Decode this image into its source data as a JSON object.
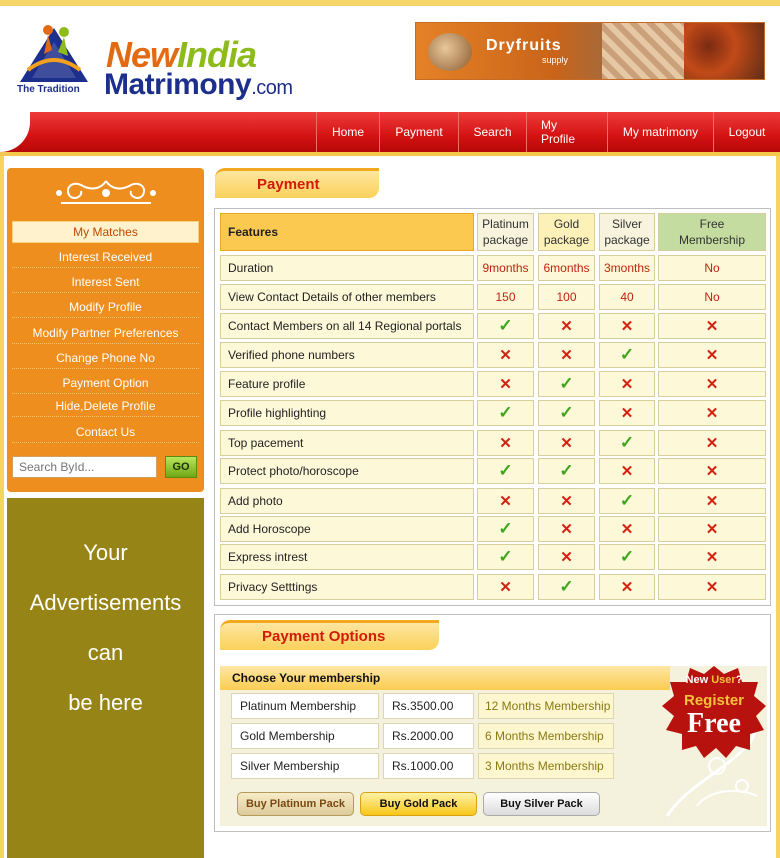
{
  "header": {
    "logo_new": "New",
    "logo_india": "India",
    "logo_matrimony": "Matrimony",
    "logo_com": ".com",
    "logo_tagline": "The Tradition",
    "ad_title": "Dryfruits",
    "ad_subtitle": "supply"
  },
  "nav": {
    "items": [
      "Home",
      "Payment",
      "Search",
      "My Profile",
      "My matrimony",
      "Logout"
    ]
  },
  "sidebar": {
    "items": [
      "My Matches",
      "Interest Received",
      "Interest Sent",
      "Modify Profile",
      "Modify Partner Preferences",
      "Change Phone No",
      "Payment Option",
      "Hide,Delete Profile",
      "Contact Us"
    ],
    "search_placeholder": "Search ById...",
    "go_label": "GO",
    "adv_lines": [
      "Your",
      "Advertisements",
      "can",
      "be here"
    ]
  },
  "payment": {
    "heading": "Payment",
    "headers": {
      "features": "Features",
      "platinum_1": "Platinum",
      "platinum_2": "package",
      "gold_1": "Gold",
      "gold_2": "package",
      "silver_1": "Silver",
      "silver_2": "package",
      "free_1": "Free",
      "free_2": "Membership"
    },
    "rows": [
      {
        "feature": "Duration",
        "platinum": "9months",
        "gold": "6months",
        "silver": "3months",
        "free": "No"
      },
      {
        "feature": "View Contact Details of other members",
        "platinum": "150",
        "gold": "100",
        "silver": "40",
        "free": "No"
      },
      {
        "feature": "Contact Members on all 14 Regional portals",
        "platinum": "yes",
        "gold": "no",
        "silver": "no",
        "free": "no"
      },
      {
        "feature": "Verified phone numbers",
        "platinum": "no",
        "gold": "no",
        "silver": "yes",
        "free": "no"
      },
      {
        "feature": "Feature profile",
        "platinum": "no",
        "gold": "yes",
        "silver": "no",
        "free": "no"
      },
      {
        "feature": "Profile highlighting",
        "platinum": "yes",
        "gold": "yes",
        "silver": "no",
        "free": "no"
      },
      {
        "feature": "Top pacement",
        "platinum": "no",
        "gold": "no",
        "silver": "yes",
        "free": "no"
      },
      {
        "feature": "Protect photo/horoscope",
        "platinum": "yes",
        "gold": "yes",
        "silver": "no",
        "free": "no"
      },
      {
        "feature": "Add photo",
        "platinum": "no",
        "gold": "no",
        "silver": "yes",
        "free": "no"
      },
      {
        "feature": "Add Horoscope",
        "platinum": "yes",
        "gold": "no",
        "silver": "no",
        "free": "no"
      },
      {
        "feature": "Express intrest",
        "platinum": "yes",
        "gold": "no",
        "silver": "yes",
        "free": "no"
      },
      {
        "feature": "Privacy Setttings",
        "platinum": "no",
        "gold": "yes",
        "silver": "no",
        "free": "no"
      }
    ]
  },
  "options": {
    "heading": "Payment Options",
    "choose_label": "Choose Your membership",
    "plans": [
      {
        "name": "Platinum Membership",
        "price": "Rs.3500.00",
        "duration": "12 Months Membership"
      },
      {
        "name": "Gold Membership",
        "price": "Rs.2000.00",
        "duration": "6 Months Membership"
      },
      {
        "name": "Silver Membership",
        "price": "Rs.1000.00",
        "duration": "3 Months Membership"
      }
    ],
    "buttons": {
      "platinum": "Buy Platinum Pack",
      "gold": "Buy Gold Pack",
      "silver": "Buy Silver Pack"
    },
    "badge": {
      "new": "New",
      "user": "User",
      "q": "?",
      "register": "Register",
      "free": "Free"
    }
  },
  "colors": {
    "accent_red": "#d41212",
    "accent_orange": "#ee8e1e",
    "tick_green": "#3ea61c",
    "cross_red": "#d22212"
  }
}
